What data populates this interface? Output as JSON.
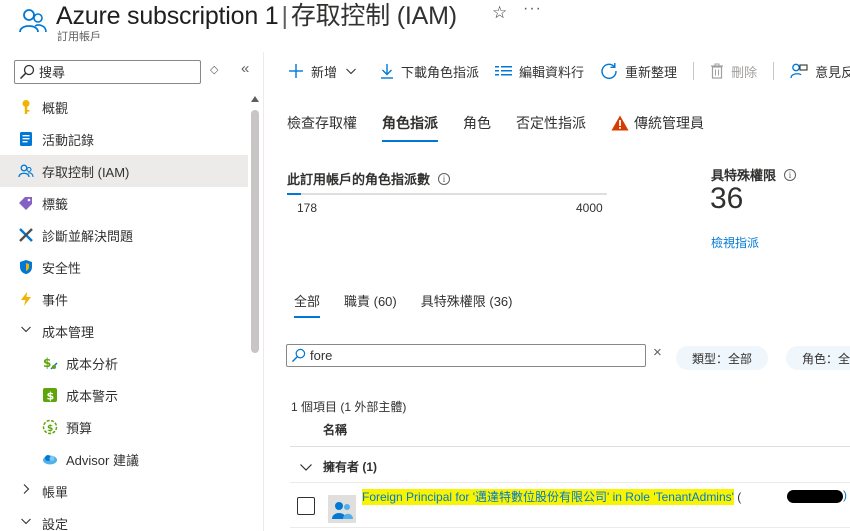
{
  "header": {
    "title": "Azure subscription 1",
    "separator": "|",
    "page": "存取控制 (IAM)",
    "subtitle": "訂用帳戶",
    "star": "☆",
    "more": "···"
  },
  "sidebar": {
    "search_placeholder": "搜尋",
    "sort_glyph": "◇",
    "collapse_glyph": "«",
    "items": [
      {
        "label": "概觀",
        "icon": "key-icon"
      },
      {
        "label": "活動記錄",
        "icon": "activity-log-icon"
      },
      {
        "label": "存取控制 (IAM)",
        "icon": "people-icon",
        "active": true
      },
      {
        "label": "標籤",
        "icon": "tag-icon"
      },
      {
        "label": "診斷並解決問題",
        "icon": "wrench-icon"
      },
      {
        "label": "安全性",
        "icon": "shield-icon"
      },
      {
        "label": "事件",
        "icon": "lightning-icon"
      },
      {
        "label": "成本管理",
        "icon": "chevron-down-icon",
        "group": true
      },
      {
        "label": "成本分析",
        "icon": "cost-analysis-icon",
        "sub": true
      },
      {
        "label": "成本警示",
        "icon": "cost-alert-icon",
        "sub": true
      },
      {
        "label": "預算",
        "icon": "budget-icon",
        "sub": true
      },
      {
        "label": "Advisor 建議",
        "icon": "advisor-icon",
        "sub": true
      },
      {
        "label": "帳單",
        "icon": "chevron-right-icon",
        "group": true
      },
      {
        "label": "設定",
        "icon": "chevron-down-icon",
        "group": true
      }
    ]
  },
  "toolbar": {
    "add": "新增",
    "download": "下載角色指派",
    "edit_columns": "編輯資料行",
    "refresh": "重新整理",
    "delete": "刪除",
    "feedback": "意見反"
  },
  "tabs": [
    "檢查存取權",
    "角色指派",
    "角色",
    "否定性指派",
    "傳統管理員"
  ],
  "stats": {
    "assignments_title": "此訂用帳戶的角色指派數",
    "assignments_value": "178",
    "assignments_max": "4000",
    "assignments_fraction": 0.0445,
    "privileged_title": "具特殊權限",
    "privileged_count": "36",
    "privileged_link": "檢視指派"
  },
  "subtabs": [
    "全部",
    "職責 (60)",
    "具特殊權限 (36)"
  ],
  "filter": {
    "value": "fore",
    "clear": "×",
    "type_pill": "類型：全部",
    "role_pill": "角色：全"
  },
  "results": {
    "count": "1 個項目 (1 外部主體)",
    "column_name": "名稱",
    "group_label": "擁有者 (1)",
    "row_name": "Foreign Principal for '邁達特數位股份有限公司' in Role 'TenantAdmins'",
    "row_open_paren": "(",
    "row_close_paren": ")"
  },
  "colors": {
    "accent": "#0078d4",
    "highlight": "#f8f400",
    "active_nav": "#edebe9"
  }
}
